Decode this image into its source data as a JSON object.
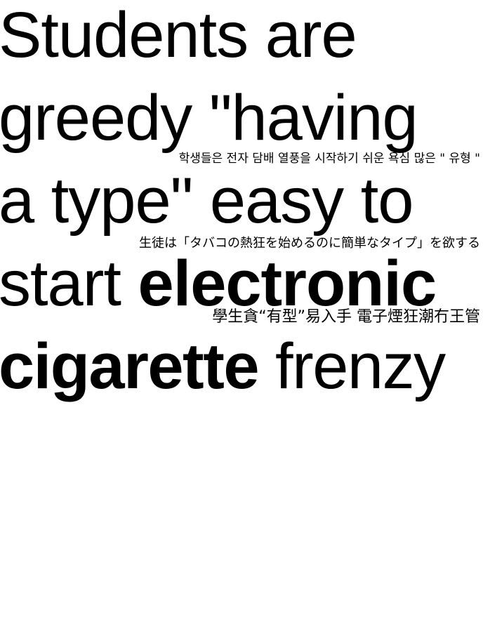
{
  "headline": {
    "line1": "Students are",
    "line2": "greedy \"having",
    "line3": "a type\" easy to",
    "line4_normal": "start ",
    "line4_bold": "electronic",
    "line5_bold": "cigarette",
    "line5_normal": " frenzy"
  },
  "translations": {
    "korean": "학생들은 전자 담배 열풍을 시작하기 쉬운 욕심 많은 \" 유형 \"",
    "japanese": "生徒は「タバコの熱狂を始めるのに簡単なタイプ」を欲する",
    "chinese": "學生貪“有型”易入手 電子煙狂潮冇王管"
  }
}
